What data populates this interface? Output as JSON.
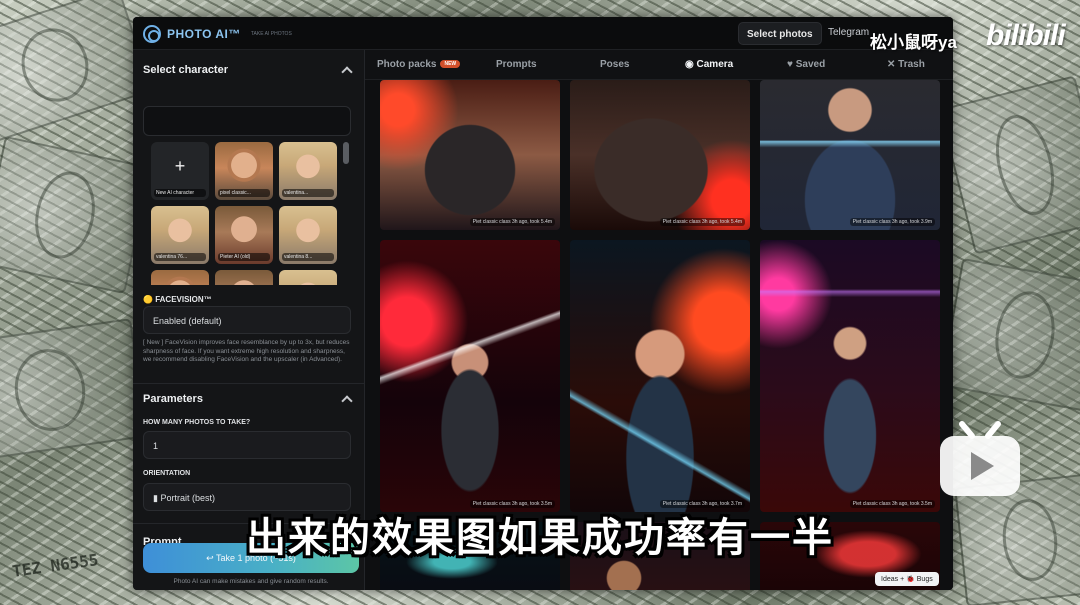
{
  "window": {
    "logo_text": "PHOTO AI™",
    "logo_subtext": "TAKE AI PHOTOS",
    "select_photos_label": "Select photos",
    "telegram_label": "Telegram"
  },
  "sidebar": {
    "select_character_title": "Select character",
    "characters": [
      {
        "name": "New AI character",
        "kind": "new"
      },
      {
        "name": "pixel classic...",
        "kind": "male"
      },
      {
        "name": "valentina...",
        "kind": "female"
      },
      {
        "name": "valentina 76...",
        "kind": "female"
      },
      {
        "name": "Pieter AI (old)",
        "kind": "male2"
      },
      {
        "name": "valentina 8...",
        "kind": "female"
      }
    ],
    "facevision_label": "FACEVISION™",
    "facevision_value": "Enabled (default)",
    "facevision_note": "[ New ] FaceVision improves face resemblance by up to 3x, but reduces sharpness of face. If you want extreme high resolution and sharpness, we recommend disabling FaceVision and the upscaler (in Advanced).",
    "parameters_title": "Parameters",
    "photos_count_label": "HOW MANY PHOTOS TO TAKE?",
    "photos_count_value": "1",
    "orientation_label": "ORIENTATION",
    "orientation_value": "▮ Portrait (best)",
    "prompt_label": "Prompt",
    "take_button_label": "↩ Take 1 photo (~51s)",
    "disclaimer": "Photo AI can make mistakes and give random results."
  },
  "tabs": [
    {
      "label": "Photo packs",
      "badge": "NEW",
      "active": false
    },
    {
      "label": "Prompts",
      "active": false
    },
    {
      "label": "Poses",
      "active": false
    },
    {
      "label": "Camera",
      "icon": "camera-icon",
      "active": true
    },
    {
      "label": "Saved",
      "icon": "heart-icon",
      "active": false
    },
    {
      "label": "Trash",
      "icon": "x-icon",
      "active": false
    }
  ],
  "gallery": {
    "photos": [
      {
        "meta": "Piet classic class 3h ago, took 5.4m"
      },
      {
        "meta": "Piet classic class 3h ago, took 5.4m"
      },
      {
        "meta": "Piet classic class 3h ago, took 3.9m"
      },
      {
        "meta": "Piet classic class 3h ago, took 3.5m"
      },
      {
        "meta": "Piet classic class 3h ago, took 3.7m"
      },
      {
        "meta": "Piet classic class 3h ago, took 3.5m"
      }
    ],
    "ideas_label": "Ideas + 🐞 Bugs"
  },
  "overlay": {
    "subtitle": "出来的效果图如果成功率有一半",
    "watermark_user": "松小鼠呀ya",
    "watermark_site": "bilibili"
  }
}
